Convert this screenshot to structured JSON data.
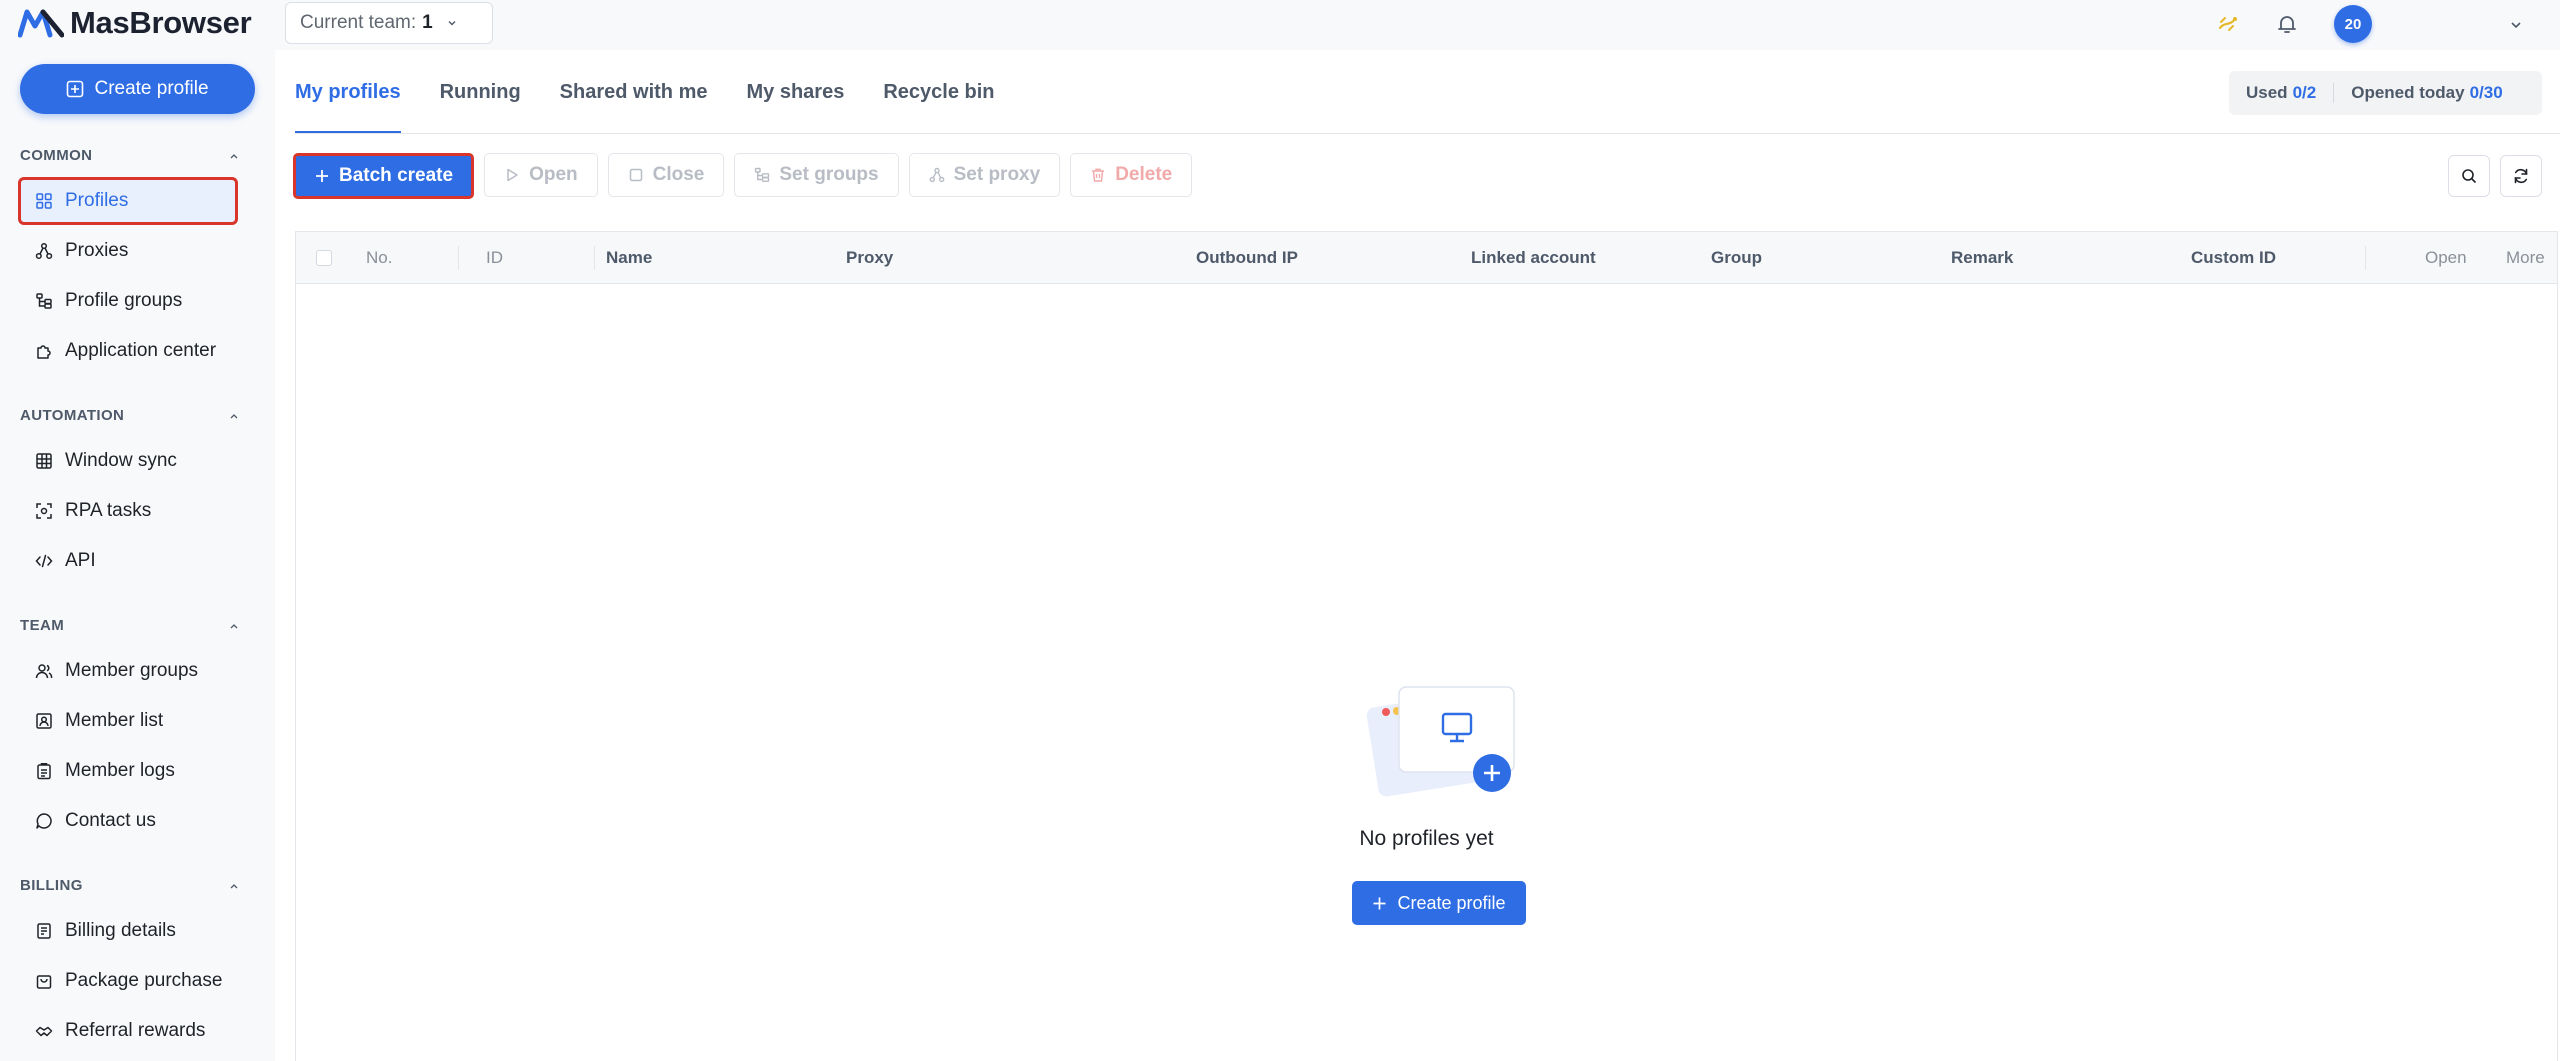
{
  "app": {
    "name": "MasBrowser",
    "team_label": "Current team:",
    "team_value": "1",
    "avatar_text": "20"
  },
  "sidebar": {
    "create_label": "Create profile",
    "sections": [
      {
        "title": "COMMON",
        "items": [
          "Profiles",
          "Proxies",
          "Profile groups",
          "Application center"
        ]
      },
      {
        "title": "AUTOMATION",
        "items": [
          "Window sync",
          "RPA tasks",
          "API"
        ]
      },
      {
        "title": "TEAM",
        "items": [
          "Member groups",
          "Member list",
          "Member logs",
          "Contact us"
        ]
      },
      {
        "title": "BILLING",
        "items": [
          "Billing details",
          "Package purchase",
          "Referral rewards"
        ]
      }
    ],
    "active_item": "Profiles"
  },
  "tabs": [
    "My profiles",
    "Running",
    "Shared with me",
    "My shares",
    "Recycle bin"
  ],
  "active_tab": "My profiles",
  "usage": {
    "used_label": "Used",
    "used_value": "0/2",
    "opened_label": "Opened today",
    "opened_value": "0/30"
  },
  "toolbar": {
    "batch_create": "Batch create",
    "open": "Open",
    "close": "Close",
    "set_groups": "Set groups",
    "set_proxy": "Set proxy",
    "delete": "Delete"
  },
  "table": {
    "columns": [
      "No.",
      "ID",
      "Name",
      "Proxy",
      "Outbound IP",
      "Linked account",
      "Group",
      "Remark",
      "Custom ID",
      "Open",
      "More"
    ]
  },
  "empty": {
    "text": "No profiles yet",
    "button": "Create profile"
  },
  "colors": {
    "accent": "#2f6de5",
    "highlight_outline": "#d9352b"
  }
}
